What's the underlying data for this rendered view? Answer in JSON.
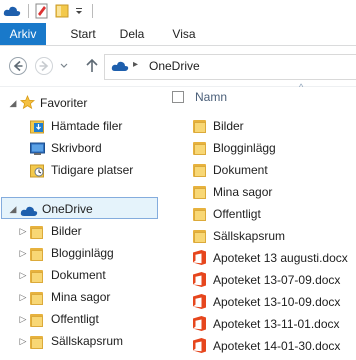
{
  "ribbon": {
    "tabs": [
      "Arkiv",
      "Start",
      "Dela",
      "Visa"
    ]
  },
  "address": {
    "breadcrumb_root": "OneDrive"
  },
  "nav": {
    "favorites_label": "Favoriter",
    "favorites_items": [
      "Hämtade filer",
      "Skrivbord",
      "Tidigare platser"
    ],
    "onedrive_label": "OneDrive",
    "onedrive_items": [
      "Bilder",
      "Blogginlägg",
      "Dokument",
      "Mina sagor",
      "Offentligt",
      "Sällskapsrum"
    ]
  },
  "content": {
    "column_header": "Namn",
    "folders": [
      "Bilder",
      "Blogginlägg",
      "Dokument",
      "Mina sagor",
      "Offentligt",
      "Sällskapsrum"
    ],
    "files": [
      "Apoteket 13 augusti.docx",
      "Apoteket 13-07-09.docx",
      "Apoteket 13-10-09.docx",
      "Apoteket 13-11-01.docx",
      "Apoteket 14-01-30.docx"
    ]
  },
  "colors": {
    "file_tab": "#1979ca",
    "selection_fill": "#e5f3fb",
    "selection_border": "#84acdd",
    "onedrive_blue": "#1e5fad",
    "office_orange": "#e6461d"
  },
  "icons": {
    "onedrive": "cloud-icon",
    "favorites": "star-icon",
    "folder": "folder-icon",
    "document": "office-doc-icon"
  }
}
